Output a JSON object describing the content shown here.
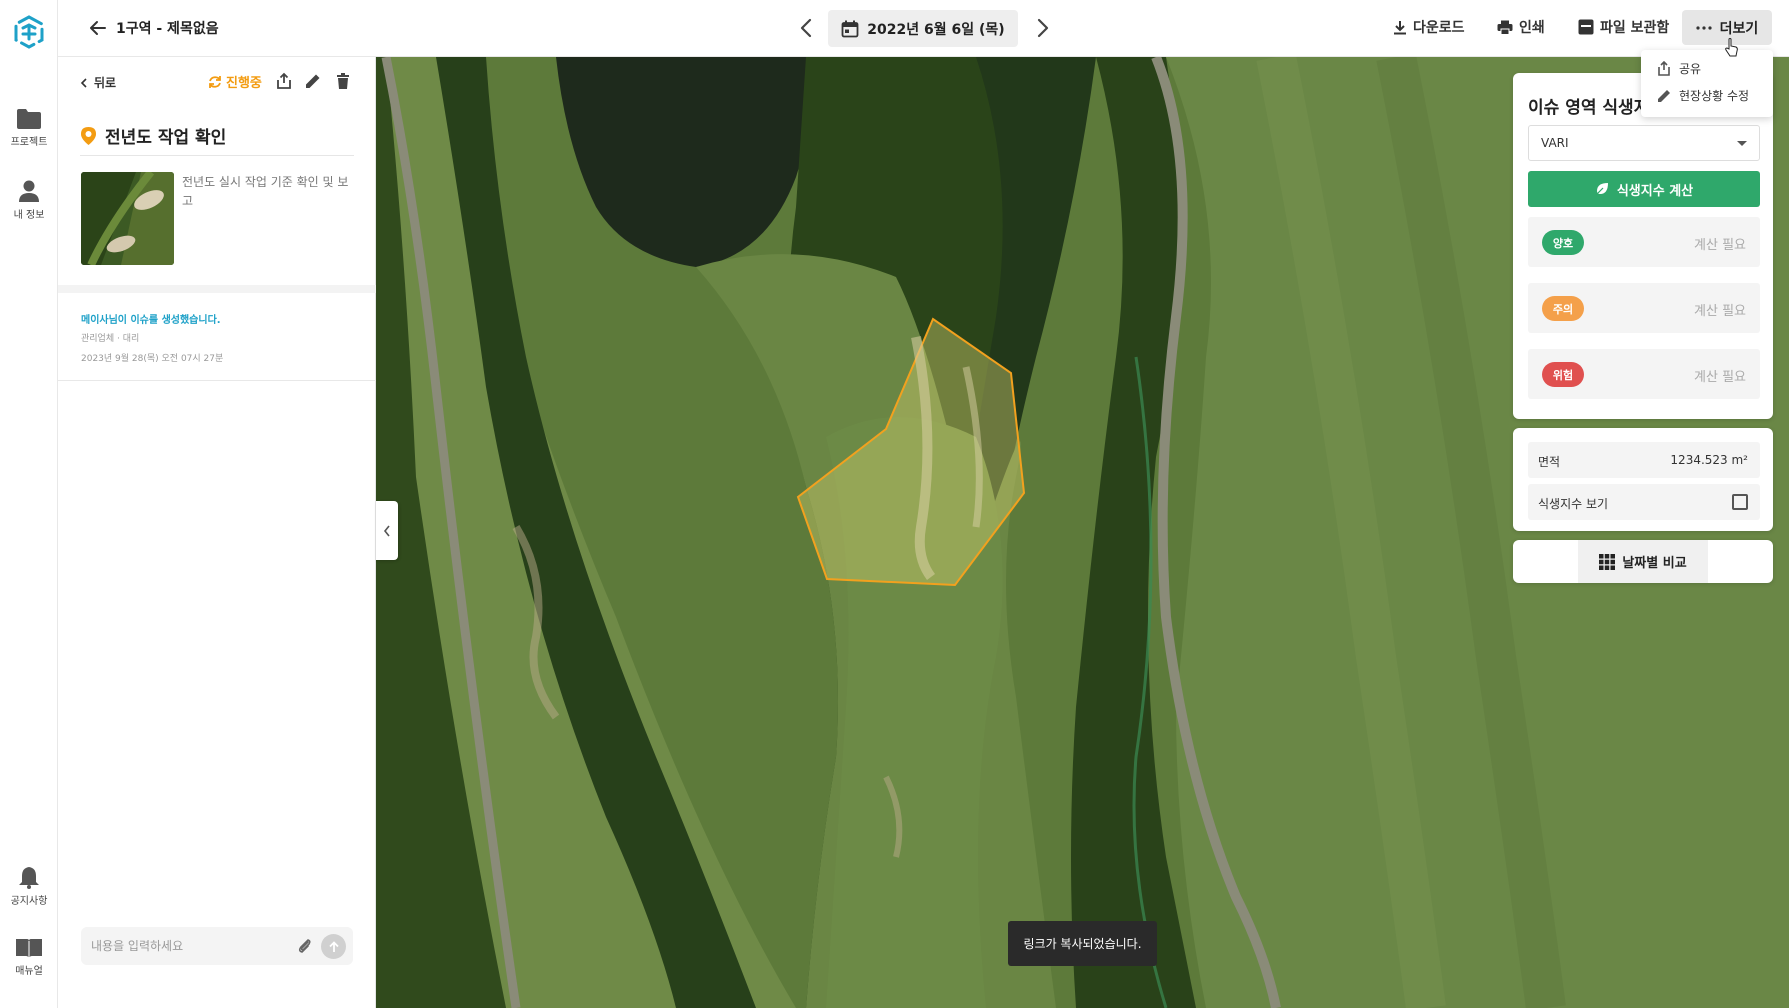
{
  "rail": {
    "items": [
      {
        "label": "프로젝트",
        "icon": "folder-icon"
      },
      {
        "label": "내 정보",
        "icon": "person-icon"
      },
      {
        "label": "공지사항",
        "icon": "bell-icon"
      },
      {
        "label": "매뉴얼",
        "icon": "book-icon"
      }
    ]
  },
  "topbar": {
    "title": "1구역 - 제목없음",
    "date": "2022년 6월 6일 (목)",
    "actions": {
      "download": "다운로드",
      "print": "인쇄",
      "archive": "파일 보관함",
      "more": "더보기"
    }
  },
  "dropdown": {
    "share": "공유",
    "edit_status": "현장상황 수정"
  },
  "panel": {
    "back": "뒤로",
    "status": "진행중",
    "issue_title": "전년도 작업 확인",
    "description": "전년도 실시 작업 기준 확인 및 보고",
    "log": {
      "title": "메이사님이 이슈를 생성했습니다.",
      "sub": "관리업체 · 대리",
      "date": "2023년 9월 28(목)   오전 07시 27분"
    },
    "input_placeholder": "내용을 입력하세요"
  },
  "toast": "링크가 복사되었습니다.",
  "vegetation": {
    "title": "이슈 영역 식생지수",
    "index_type": "VARI",
    "calc_button": "식생지수 계산",
    "rows": [
      {
        "label": "양호",
        "value": "계산 필요",
        "color": "#2fa86b"
      },
      {
        "label": "주의",
        "value": "계산 필요",
        "color": "#f4a04a"
      },
      {
        "label": "위험",
        "value": "계산 필요",
        "color": "#e0504f"
      }
    ]
  },
  "area": {
    "label": "면적",
    "value": "1234.523 m²",
    "toggle_label": "식생지수 보기"
  },
  "compare": {
    "label": "날짜별 비교"
  },
  "colors": {
    "accent_green": "#2fa86b",
    "status_orange": "#f39c12",
    "log_blue": "#1ea1c8",
    "polygon_stroke": "#f2a11e"
  }
}
